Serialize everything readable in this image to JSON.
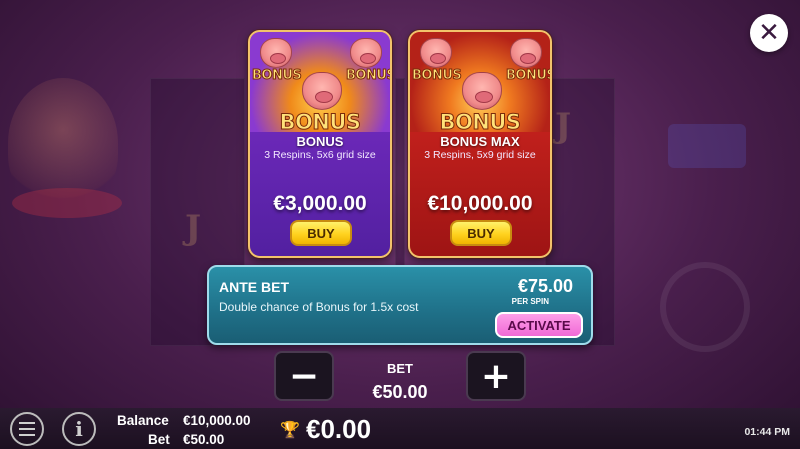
{
  "close": {
    "glyph": "✕"
  },
  "cards": [
    {
      "logo_small_left": "BONUS",
      "logo_small_right": "BONUS",
      "logo_big": "BONUS",
      "title": "BONUS",
      "description": "3 Respins, 5x6 grid size",
      "price": "€3,000.00",
      "buy_label": "BUY"
    },
    {
      "logo_small_left": "BONUS",
      "logo_small_right": "BONUS",
      "logo_big": "BONUS",
      "title": "BONUS MAX",
      "description": "3 Respins, 5x9 grid size",
      "price": "€10,000.00",
      "buy_label": "BUY"
    }
  ],
  "ante_bet": {
    "title": "ANTE BET",
    "description": "Double chance of Bonus for 1.5x cost",
    "price": "€75.00",
    "per_spin": "PER SPIN",
    "activate_label": "ACTIVATE"
  },
  "bet_controls": {
    "minus": "−",
    "plus": "+",
    "label": "BET",
    "value": "€50.00"
  },
  "footer": {
    "info_glyph": "i",
    "balance_label": "Balance",
    "balance_value": "€10,000.00",
    "bet_label": "Bet",
    "bet_value": "€50.00",
    "trophy_glyph": "🏆",
    "win_value": "€0.00",
    "time": "01:44 PM"
  },
  "colors": {
    "bonus_card": "#6b28b8",
    "bonus_max_card": "#c0201c",
    "ante_panel": "#1f7088",
    "buy_button": "#ffd21f",
    "activate_button": "#f06ad6"
  }
}
